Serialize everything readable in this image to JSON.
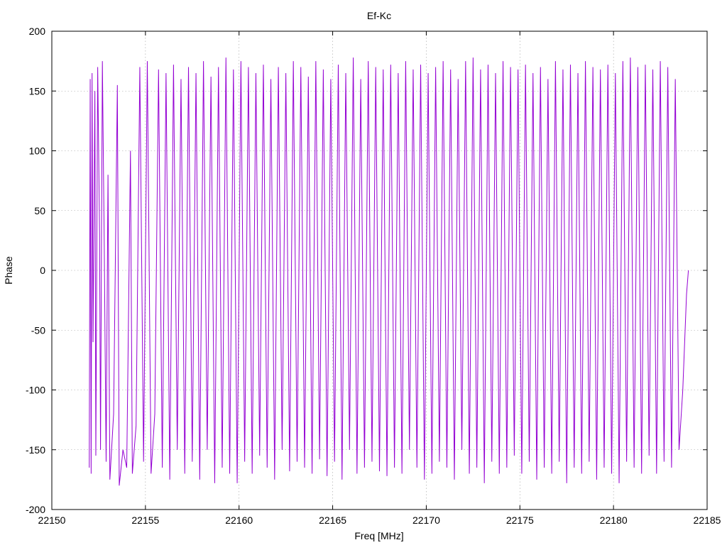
{
  "chart_data": {
    "type": "line",
    "title": "Ef-Kc",
    "xlabel": "Freq [MHz]",
    "ylabel": "Phase",
    "xlim": [
      22150,
      22185
    ],
    "ylim": [
      -200,
      200
    ],
    "xticks": [
      22150,
      22155,
      22160,
      22165,
      22170,
      22175,
      22180,
      22185
    ],
    "yticks": [
      -200,
      -150,
      -100,
      -50,
      0,
      50,
      100,
      150,
      200
    ],
    "grid": true,
    "line_color": "#9400d3",
    "series": [
      {
        "x_start": 22152.0,
        "x_end": 22184.0,
        "points": [
          [
            22152.0,
            -165
          ],
          [
            22152.05,
            160
          ],
          [
            22152.1,
            -170
          ],
          [
            22152.15,
            165
          ],
          [
            22152.2,
            -60
          ],
          [
            22152.3,
            150
          ],
          [
            22152.35,
            -155
          ],
          [
            22152.45,
            170
          ],
          [
            22152.55,
            30
          ],
          [
            22152.6,
            -150
          ],
          [
            22152.7,
            175
          ],
          [
            22152.8,
            20
          ],
          [
            22152.9,
            -160
          ],
          [
            22153.0,
            80
          ],
          [
            22153.1,
            -175
          ],
          [
            22153.3,
            -120
          ],
          [
            22153.5,
            155
          ],
          [
            22153.6,
            -180
          ],
          [
            22153.8,
            -150
          ],
          [
            22154.0,
            -165
          ],
          [
            22154.2,
            100
          ],
          [
            22154.3,
            -170
          ],
          [
            22154.5,
            -130
          ],
          [
            22154.7,
            170
          ],
          [
            22154.9,
            -160
          ],
          [
            22155.1,
            175
          ],
          [
            22155.3,
            -170
          ],
          [
            22155.5,
            -120
          ],
          [
            22155.7,
            168
          ],
          [
            22155.9,
            -165
          ],
          [
            22156.1,
            165
          ],
          [
            22156.3,
            -175
          ],
          [
            22156.5,
            172
          ],
          [
            22156.7,
            -150
          ],
          [
            22156.9,
            160
          ],
          [
            22157.1,
            -170
          ],
          [
            22157.3,
            170
          ],
          [
            22157.5,
            -160
          ],
          [
            22157.7,
            165
          ],
          [
            22157.9,
            -175
          ],
          [
            22158.1,
            175
          ],
          [
            22158.3,
            -150
          ],
          [
            22158.5,
            162
          ],
          [
            22158.7,
            -178
          ],
          [
            22158.9,
            170
          ],
          [
            22159.1,
            -165
          ],
          [
            22159.3,
            178
          ],
          [
            22159.5,
            -170
          ],
          [
            22159.7,
            168
          ],
          [
            22159.9,
            -178
          ],
          [
            22160.1,
            175
          ],
          [
            22160.3,
            -160
          ],
          [
            22160.5,
            170
          ],
          [
            22160.7,
            -170
          ],
          [
            22160.9,
            165
          ],
          [
            22161.1,
            -155
          ],
          [
            22161.3,
            172
          ],
          [
            22161.5,
            -165
          ],
          [
            22161.7,
            160
          ],
          [
            22161.9,
            -175
          ],
          [
            22162.1,
            170
          ],
          [
            22162.3,
            -150
          ],
          [
            22162.5,
            165
          ],
          [
            22162.7,
            -168
          ],
          [
            22162.9,
            175
          ],
          [
            22163.1,
            -160
          ],
          [
            22163.3,
            170
          ],
          [
            22163.5,
            -165
          ],
          [
            22163.7,
            162
          ],
          [
            22163.9,
            -170
          ],
          [
            22164.1,
            175
          ],
          [
            22164.3,
            -158
          ],
          [
            22164.5,
            168
          ],
          [
            22164.7,
            -172
          ],
          [
            22164.9,
            160
          ],
          [
            22165.1,
            -160
          ],
          [
            22165.3,
            172
          ],
          [
            22165.5,
            -175
          ],
          [
            22165.7,
            165
          ],
          [
            22165.9,
            -150
          ],
          [
            22166.1,
            178
          ],
          [
            22166.3,
            -170
          ],
          [
            22166.5,
            160
          ],
          [
            22166.7,
            -165
          ],
          [
            22166.9,
            175
          ],
          [
            22167.1,
            -160
          ],
          [
            22167.3,
            170
          ],
          [
            22167.5,
            -168
          ],
          [
            22167.7,
            168
          ],
          [
            22167.9,
            -172
          ],
          [
            22168.1,
            172
          ],
          [
            22168.3,
            -165
          ],
          [
            22168.5,
            165
          ],
          [
            22168.7,
            -170
          ],
          [
            22168.9,
            175
          ],
          [
            22169.1,
            -150
          ],
          [
            22169.3,
            168
          ],
          [
            22169.5,
            -165
          ],
          [
            22169.7,
            172
          ],
          [
            22169.9,
            -175
          ],
          [
            22170.1,
            165
          ],
          [
            22170.3,
            -170
          ],
          [
            22170.5,
            170
          ],
          [
            22170.7,
            -160
          ],
          [
            22170.9,
            175
          ],
          [
            22171.1,
            -165
          ],
          [
            22171.3,
            168
          ],
          [
            22171.5,
            -175
          ],
          [
            22171.7,
            160
          ],
          [
            22171.9,
            -150
          ],
          [
            22172.1,
            175
          ],
          [
            22172.3,
            -170
          ],
          [
            22172.5,
            178
          ],
          [
            22172.7,
            -165
          ],
          [
            22172.9,
            168
          ],
          [
            22173.1,
            -178
          ],
          [
            22173.3,
            172
          ],
          [
            22173.5,
            -160
          ],
          [
            22173.7,
            165
          ],
          [
            22173.9,
            -170
          ],
          [
            22174.1,
            175
          ],
          [
            22174.3,
            -165
          ],
          [
            22174.5,
            170
          ],
          [
            22174.7,
            -155
          ],
          [
            22174.9,
            168
          ],
          [
            22175.1,
            -170
          ],
          [
            22175.3,
            172
          ],
          [
            22175.5,
            -160
          ],
          [
            22175.7,
            165
          ],
          [
            22175.9,
            -175
          ],
          [
            22176.1,
            170
          ],
          [
            22176.3,
            -165
          ],
          [
            22176.5,
            160
          ],
          [
            22176.7,
            -170
          ],
          [
            22176.9,
            175
          ],
          [
            22177.1,
            -160
          ],
          [
            22177.3,
            168
          ],
          [
            22177.5,
            -178
          ],
          [
            22177.7,
            172
          ],
          [
            22177.9,
            -165
          ],
          [
            22178.1,
            165
          ],
          [
            22178.3,
            -170
          ],
          [
            22178.5,
            175
          ],
          [
            22178.7,
            -160
          ],
          [
            22178.9,
            170
          ],
          [
            22179.1,
            -175
          ],
          [
            22179.3,
            168
          ],
          [
            22179.5,
            -165
          ],
          [
            22179.7,
            172
          ],
          [
            22179.9,
            -170
          ],
          [
            22180.1,
            165
          ],
          [
            22180.3,
            -178
          ],
          [
            22180.5,
            175
          ],
          [
            22180.7,
            -160
          ],
          [
            22180.9,
            178
          ],
          [
            22181.1,
            -165
          ],
          [
            22181.3,
            170
          ],
          [
            22181.5,
            -170
          ],
          [
            22181.7,
            172
          ],
          [
            22181.9,
            -155
          ],
          [
            22182.1,
            168
          ],
          [
            22182.3,
            -170
          ],
          [
            22182.5,
            175
          ],
          [
            22182.7,
            -160
          ],
          [
            22182.9,
            170
          ],
          [
            22183.1,
            -165
          ],
          [
            22183.3,
            160
          ],
          [
            22183.5,
            -150
          ],
          [
            22183.7,
            -100
          ],
          [
            22183.8,
            -60
          ],
          [
            22183.9,
            -20
          ],
          [
            22184.0,
            0
          ]
        ]
      }
    ]
  }
}
